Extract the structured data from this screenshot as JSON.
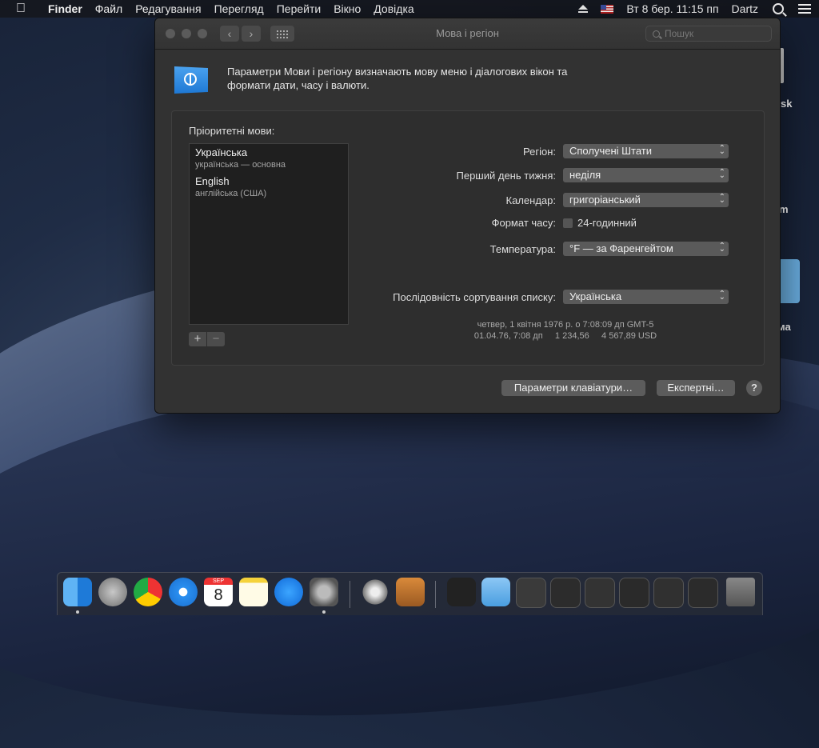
{
  "menubar": {
    "apple": "",
    "app": "Finder",
    "items": [
      "Файл",
      "Редагування",
      "Перегляд",
      "Перейти",
      "Вікно",
      "Довідка"
    ],
    "datetime": "Вт 8 бер.  11:15 пп",
    "user": "Dartz"
  },
  "desktop": {
    "labels": [
      "sk",
      "m",
      "ма"
    ]
  },
  "window": {
    "title": "Мова і регіон",
    "search_placeholder": "Пошук",
    "description": "Параметри Мови і регіону визначають мову меню і діалогових вікон та формати дати, часу і валюти.",
    "preferred_languages_label": "Пріоритетні мови:",
    "languages": [
      {
        "name": "Українська",
        "sub": "українська — основна"
      },
      {
        "name": "English",
        "sub": "англійська (США)"
      }
    ],
    "add": "+",
    "remove": "−",
    "region_label": "Регіон:",
    "region_value": "Сполучені Штати",
    "first_day_label": "Перший день тижня:",
    "first_day_value": "неділя",
    "calendar_label": "Календар:",
    "calendar_value": "григоріанський",
    "time_format_label": "Формат часу:",
    "time_format_value": "24-годинний",
    "time_format_checked": false,
    "temperature_label": "Температура:",
    "temperature_value": "°F — за Фаренгейтом",
    "sort_label": "Послідовність сортування списку:",
    "sort_value": "Українська",
    "sample_line1": "четвер, 1 квітня 1976 р. о 7:08:09 дп GMT-5",
    "sample_line2": "01.04.76, 7:08 дп     1 234,56     4 567,89 USD",
    "keyboard_button": "Параметри клавіатури…",
    "advanced_button": "Експертні…",
    "help": "?"
  },
  "dock": {
    "apps": [
      "finder-icon",
      "launchpad-icon",
      "chrome-icon",
      "safari-icon",
      "calendar-icon",
      "notes-icon",
      "app-store-icon",
      "system-preferences-icon",
      "automator-icon",
      "text-editor-icon",
      "activity-monitor-icon",
      "folder-icon",
      "window-thumbnail",
      "window-thumbnail",
      "window-thumbnail",
      "window-thumbnail",
      "window-thumbnail",
      "window-thumbnail",
      "trash-icon"
    ],
    "calendar_month": "SEP",
    "calendar_day": "8"
  }
}
